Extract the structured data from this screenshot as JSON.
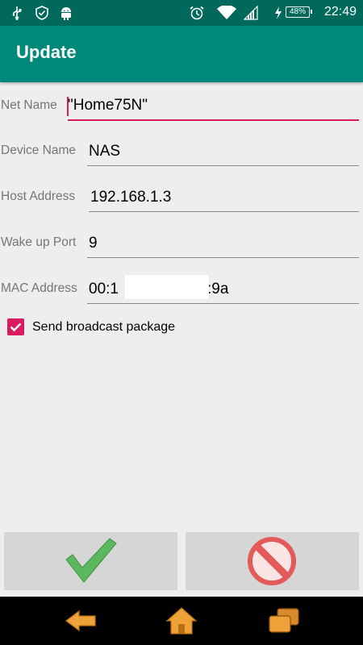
{
  "status_bar": {
    "time": "22:49",
    "battery": "48%",
    "icons": [
      "usb-icon",
      "shield-icon",
      "android-icon",
      "alarm-icon",
      "wifi-icon",
      "signal-icon",
      "charging-icon",
      "battery-icon"
    ]
  },
  "app_bar": {
    "title": "Update"
  },
  "form": {
    "net_name": {
      "label": "Net Name",
      "value": "\"Home75N\""
    },
    "device_name": {
      "label": "Device Name",
      "value": "NAS"
    },
    "host_address": {
      "label": "Host Address",
      "value": "192.168.1.3"
    },
    "wake_up_port": {
      "label": "Wake up Port",
      "value": "9"
    },
    "mac_address": {
      "label": "MAC Address",
      "value_start": "00:1",
      "value_end": ":9a"
    },
    "broadcast": {
      "label": "Send broadcast package",
      "checked": true
    }
  },
  "actions": {
    "confirm_icon": "checkmark-icon",
    "cancel_icon": "prohibited-icon"
  },
  "nav_bar": {
    "icons": [
      "back-icon",
      "home-icon",
      "recent-apps-icon"
    ]
  },
  "colors": {
    "status_bar": "#00695c",
    "app_bar": "#00897b",
    "accent": "#d81b60",
    "background": "#eeeeee",
    "button": "#d6d6d6"
  }
}
